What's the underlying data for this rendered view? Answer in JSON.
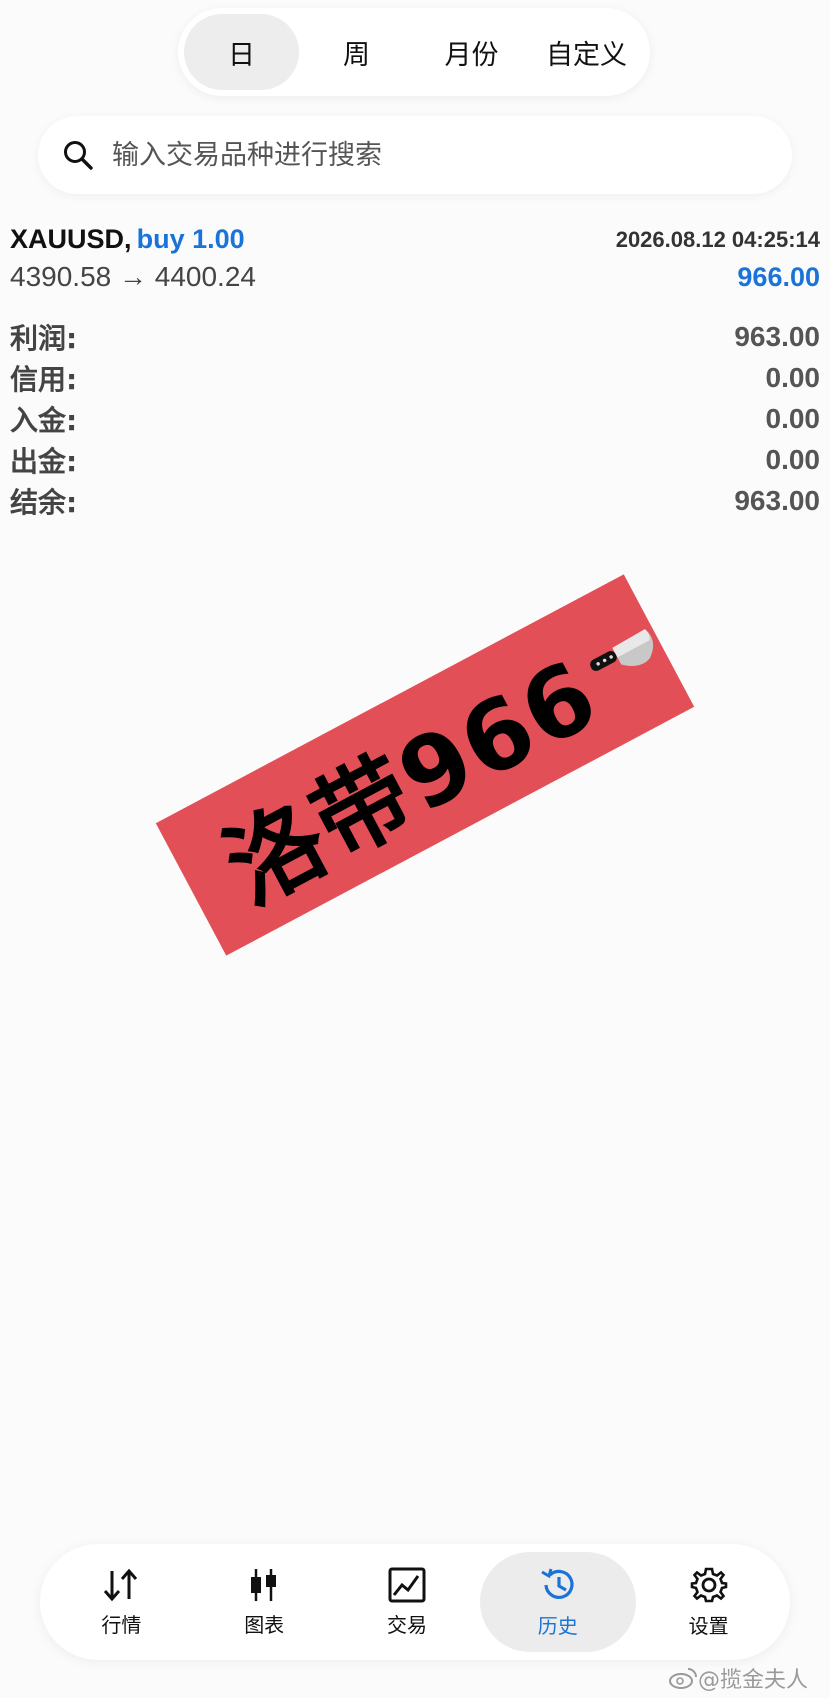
{
  "period_tabs": [
    "日",
    "周",
    "月份",
    "自定义"
  ],
  "search": {
    "placeholder": "输入交易品种进行搜索"
  },
  "deal": {
    "symbol": "XAUUSD,",
    "direction": "buy 1.00",
    "time": "2026.08.12 04:25:14",
    "prices": "4390.58 → 4400.24",
    "profit": "966.00"
  },
  "summary": [
    {
      "label": "利润:",
      "value": "963.00"
    },
    {
      "label": "信用:",
      "value": "0.00"
    },
    {
      "label": "入金:",
      "value": "0.00"
    },
    {
      "label": "出金:",
      "value": "0.00"
    },
    {
      "label": "结余:",
      "value": "963.00"
    }
  ],
  "stamp": {
    "text": "洛带966",
    "icon": "knife-icon",
    "color": "#e34f57"
  },
  "tabbar": [
    {
      "label": "行情",
      "icon": "quotes-arrows-icon"
    },
    {
      "label": "图表",
      "icon": "candlestick-chart-icon"
    },
    {
      "label": "交易",
      "icon": "trade-line-chart-icon"
    },
    {
      "label": "历史",
      "icon": "history-clock-icon",
      "active": true
    },
    {
      "label": "设置",
      "icon": "gear-icon"
    }
  ],
  "watermark": {
    "text": "@揽金夫人",
    "icon": "weibo-icon"
  },
  "colors": {
    "accent": "#1a73d9",
    "background": "#fbfbfb"
  }
}
